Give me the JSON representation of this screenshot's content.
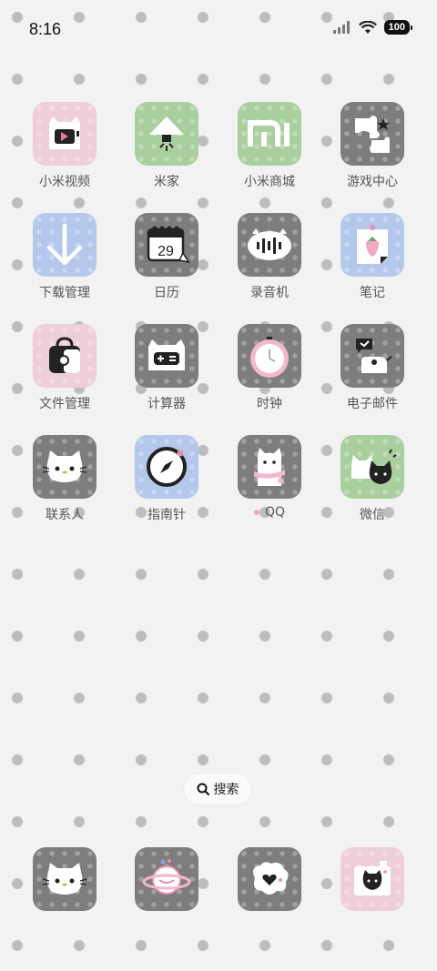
{
  "status": {
    "time": "8:16",
    "battery": "100"
  },
  "apps": [
    {
      "label": "小米视频",
      "icon": "video-player-icon",
      "color": "#efcedb"
    },
    {
      "label": "米家",
      "icon": "lamp-icon",
      "color": "#a9cf9f"
    },
    {
      "label": "小米商城",
      "icon": "mi-logo-icon",
      "color": "#a9cf9f"
    },
    {
      "label": "游戏中心",
      "icon": "puzzle-icon",
      "color": "#7d7d7d"
    },
    {
      "label": "下载管理",
      "icon": "download-arrow-icon",
      "color": "#b4c8ec"
    },
    {
      "label": "日历",
      "icon": "calendar-icon",
      "color": "#7d7d7d",
      "calendar_day": "29"
    },
    {
      "label": "录音机",
      "icon": "voice-recorder-icon",
      "color": "#7d7d7d"
    },
    {
      "label": "笔记",
      "icon": "strawberry-note-icon",
      "color": "#b4c8ec"
    },
    {
      "label": "文件管理",
      "icon": "bag-folder-icon",
      "color": "#efcedb"
    },
    {
      "label": "计算器",
      "icon": "calculator-icon",
      "color": "#7d7d7d"
    },
    {
      "label": "时钟",
      "icon": "clock-icon",
      "color": "#7d7d7d"
    },
    {
      "label": "电子邮件",
      "icon": "mail-speech-icon",
      "color": "#7d7d7d"
    },
    {
      "label": "联系人",
      "icon": "kitty-contacts-icon",
      "color": "#7d7d7d"
    },
    {
      "label": "指南针",
      "icon": "compass-icon",
      "color": "#b4c8ec"
    },
    {
      "label": "QQ",
      "icon": "cat-qq-icon",
      "color": "#7d7d7d",
      "new_dot": true
    },
    {
      "label": "微信",
      "icon": "black-cat-chat-icon",
      "color": "#a9cf9f"
    }
  ],
  "search": {
    "label": "搜索"
  },
  "dock": [
    {
      "icon": "kitty-phone-icon",
      "color": "#7d7d7d"
    },
    {
      "icon": "planet-messages-icon",
      "color": "#7d7d7d"
    },
    {
      "icon": "heart-bubble-browser-icon",
      "color": "#7d7d7d"
    },
    {
      "icon": "cat-camera-icon",
      "color": "#efcedb"
    }
  ]
}
